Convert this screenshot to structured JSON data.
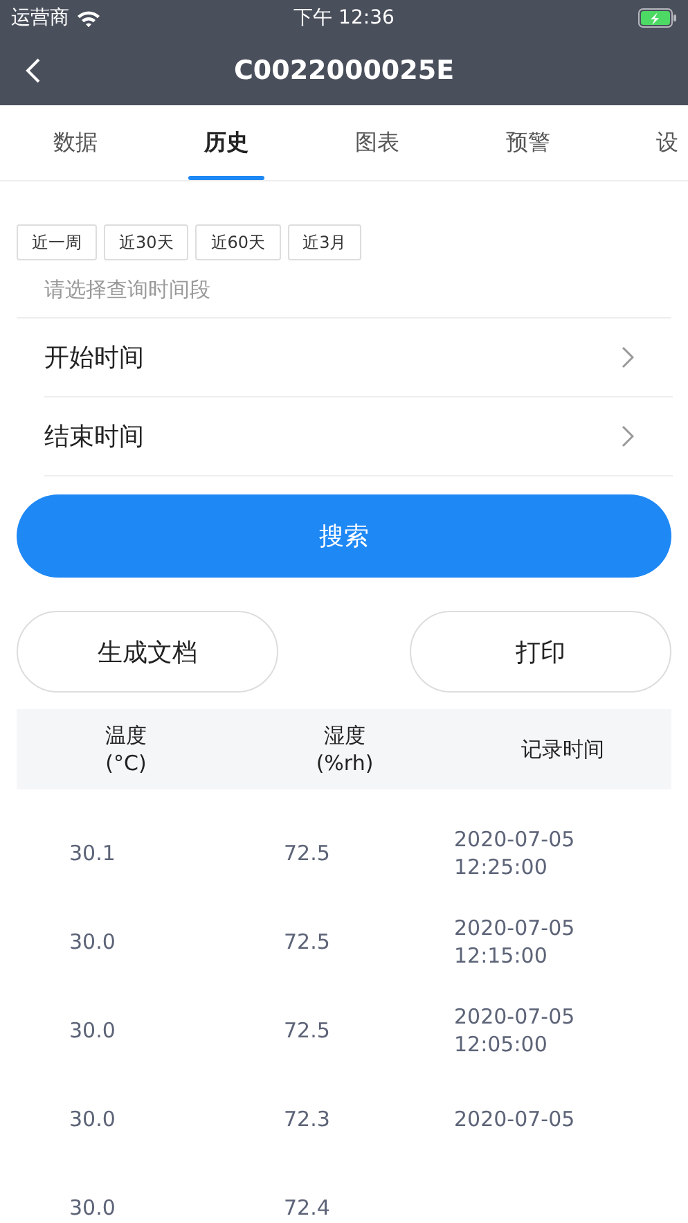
{
  "status_bar": {
    "carrier": "运营商",
    "time": "下午 12:36"
  },
  "nav": {
    "title": "C0022000025E"
  },
  "tabs": [
    {
      "label": "数据",
      "selected": false
    },
    {
      "label": "历史",
      "selected": true
    },
    {
      "label": "图表",
      "selected": false
    },
    {
      "label": "预警",
      "selected": false
    },
    {
      "label": "设",
      "selected": false
    }
  ],
  "quick_ranges": [
    "近一周",
    "近30天",
    "近60天",
    "近3月"
  ],
  "range_hint": "请选择查询时间段",
  "pickers": [
    {
      "label": "开始时间"
    },
    {
      "label": "结束时间"
    }
  ],
  "search_button": "搜索",
  "actions": [
    "生成文档",
    "打印"
  ],
  "table": {
    "columns": [
      "温度\n(°C)",
      "湿度\n(%rh)",
      "记录时间"
    ],
    "rows": [
      [
        "30.1",
        "72.5",
        "2020-07-05\n12:25:00"
      ],
      [
        "30.0",
        "72.5",
        "2020-07-05\n12:15:00"
      ],
      [
        "30.0",
        "72.5",
        "2020-07-05\n12:05:00"
      ],
      [
        "30.0",
        "72.3",
        "2020-07-05"
      ],
      [
        "30.0",
        "72.4",
        ""
      ]
    ]
  }
}
